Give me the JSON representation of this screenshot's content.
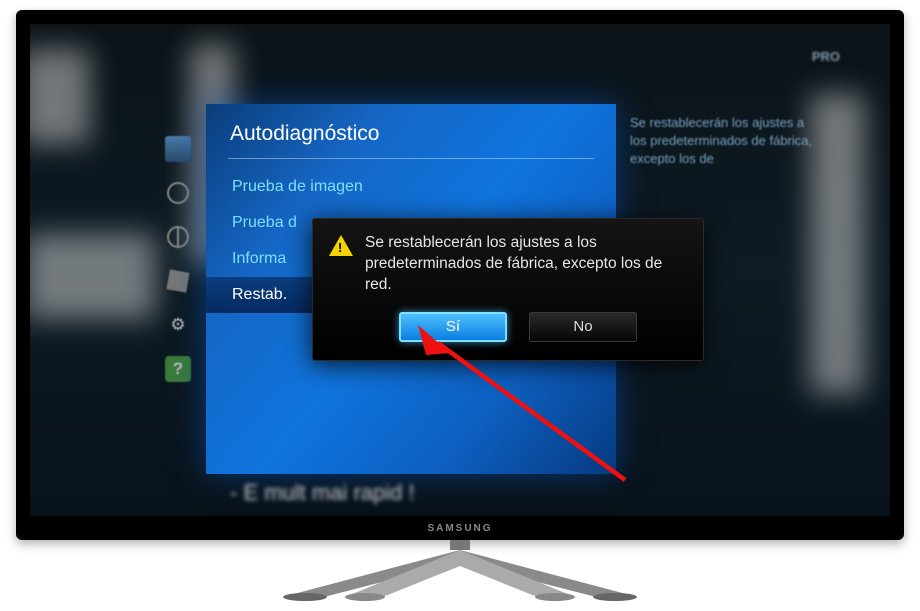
{
  "tv": {
    "brand": "SAMSUNG"
  },
  "background": {
    "pro_logo": "PRO",
    "subtitle": "- E mult mai rapid !"
  },
  "menu": {
    "title": "Autodiagnóstico",
    "items": [
      {
        "label": "Prueba de imagen",
        "highlight": false
      },
      {
        "label": "Prueba d",
        "highlight": false
      },
      {
        "label": "Informa",
        "highlight": false
      },
      {
        "label": "Restab.",
        "highlight": true
      }
    ]
  },
  "help_text": "Se restablecerán los ajustes a los predeterminados de fábrica, excepto los de",
  "dialog": {
    "message": "Se restablecerán los ajustes a los predeterminados de fábrica, excepto los de red.",
    "yes": "Sí",
    "no": "No"
  },
  "icons": {
    "picture": "picture-icon",
    "sound": "sound-icon",
    "network": "network-icon",
    "system": "system-icon",
    "settings": "gear-icon",
    "support": "help-icon",
    "warning": "warning-icon"
  }
}
